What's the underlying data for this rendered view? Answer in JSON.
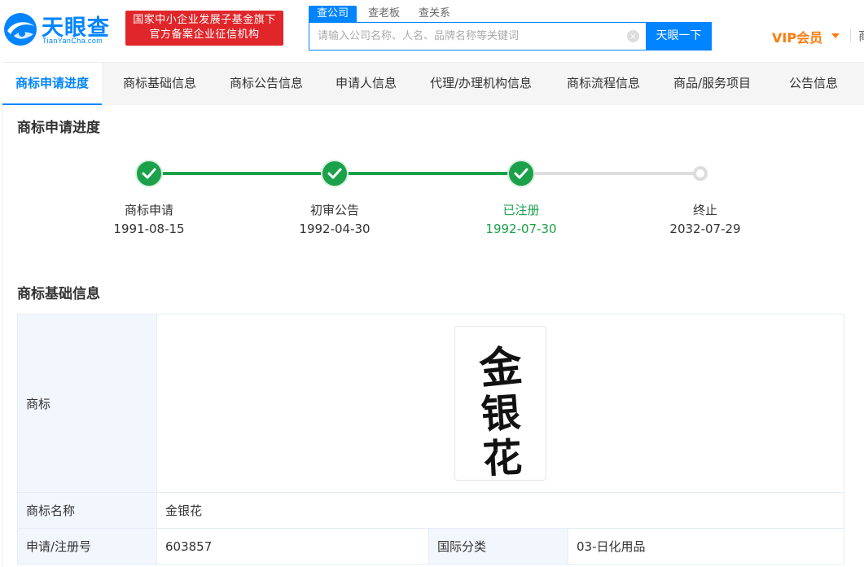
{
  "header": {
    "logo_title": "天眼查",
    "logo_sub": "TianYanCha.com",
    "badge_line1": "国家中小企业发展子基金旗下",
    "badge_line2": "官方备案企业征信机构",
    "search_tabs": [
      "查公司",
      "查老板",
      "查关系"
    ],
    "search_placeholder": "请输入公司名称、人名、品牌名称等关键词",
    "clear_icon": "×",
    "search_button": "天眼一下",
    "vip_label": "VIP会员",
    "more_label": "商"
  },
  "nav": {
    "tabs": [
      "商标申请进度",
      "商标基础信息",
      "商标公告信息",
      "申请人信息",
      "代理/办理机构信息",
      "商标流程信息",
      "商品/服务项目",
      "公告信息"
    ]
  },
  "progress": {
    "title": "商标申请进度",
    "steps": [
      {
        "name": "商标申请",
        "date": "1991-08-15",
        "status": "done"
      },
      {
        "name": "初审公告",
        "date": "1992-04-30",
        "status": "done"
      },
      {
        "name": "已注册",
        "date": "1992-07-30",
        "status": "current"
      },
      {
        "name": "终止",
        "date": "2032-07-29",
        "status": "pending"
      }
    ]
  },
  "basic": {
    "title": "商标基础信息",
    "trademark_label": "商标",
    "trademark_text": "金银花",
    "name_label": "商标名称",
    "name_value": "金银花",
    "reg_no_label": "申请/注册号",
    "reg_no_value": "603857",
    "intl_class_label": "国际分类",
    "intl_class_value": "03-日化用品"
  },
  "colors": {
    "brand_blue": "#0084ff",
    "badge_red": "#e0262a",
    "success_green": "#1ba14a",
    "vip_orange": "#ff7a0b"
  }
}
